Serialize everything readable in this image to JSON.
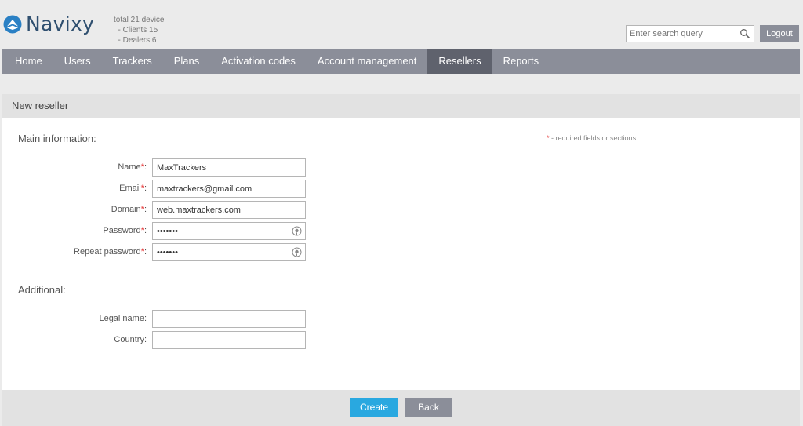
{
  "brand": {
    "name": "Navixy"
  },
  "stats": {
    "total": "total 21 device",
    "clients": "  - Clients 15",
    "dealers": "  - Dealers 6"
  },
  "search": {
    "placeholder": "Enter search query"
  },
  "logout_label": "Logout",
  "nav": {
    "items": [
      {
        "label": "Home"
      },
      {
        "label": "Users"
      },
      {
        "label": "Trackers"
      },
      {
        "label": "Plans"
      },
      {
        "label": "Activation codes"
      },
      {
        "label": "Account management"
      },
      {
        "label": "Resellers"
      },
      {
        "label": "Reports"
      }
    ],
    "active": "Resellers"
  },
  "page": {
    "title": "New reseller"
  },
  "required_note": {
    "star": "*",
    "text": " - required fields or sections"
  },
  "main_info": {
    "title": "Main information:",
    "name": {
      "label": "Name",
      "value": "MaxTrackers"
    },
    "email": {
      "label": "Email",
      "value": "maxtrackers@gmail.com"
    },
    "domain": {
      "label": "Domain",
      "value": "web.maxtrackers.com"
    },
    "password": {
      "label": "Password",
      "value": "•••••••"
    },
    "repeat": {
      "label": "Repeat password",
      "value": "•••••••"
    }
  },
  "additional": {
    "title": "Additional:",
    "legal_name": {
      "label": "Legal name:",
      "value": ""
    },
    "country": {
      "label": "Country:",
      "value": ""
    }
  },
  "required_mark": "*",
  "colon": ":",
  "actions": {
    "create": "Create",
    "back": "Back"
  },
  "colors": {
    "accent": "#29a8e0",
    "nav": "#8b8e99",
    "nav_active": "#5f626d",
    "required": "#e53b3b"
  }
}
